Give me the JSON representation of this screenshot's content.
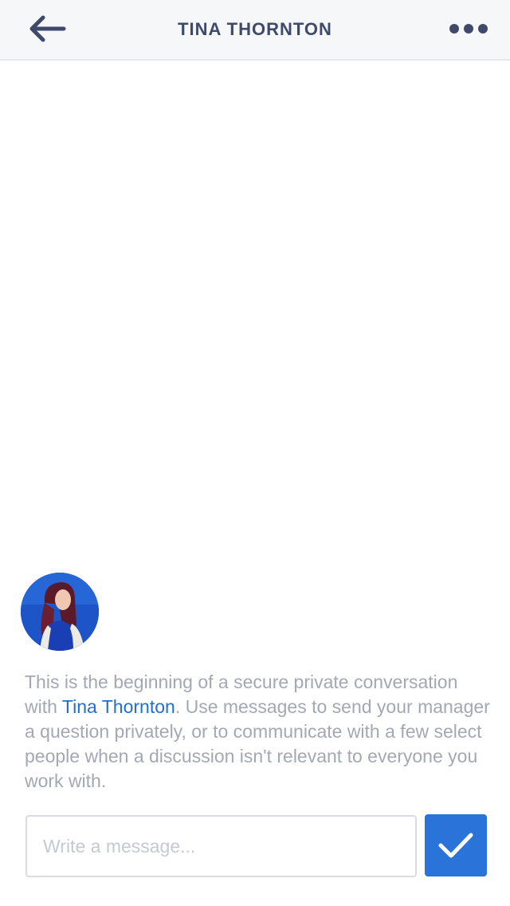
{
  "header": {
    "title": "TINA THORNTON",
    "back_icon": "arrow-left-icon",
    "more_icon": "more-dots-icon"
  },
  "intro": {
    "text_before": "This is the beginning of a secure private conversation with ",
    "contact_name": "Tina Thornton",
    "text_after": ". Use messages to send your manager a question privately, or to communicate with a few select people when a discussion isn't  relevant to everyone you work with."
  },
  "composer": {
    "placeholder": "Write a message...",
    "value": "",
    "send_icon": "checkmark-icon"
  },
  "colors": {
    "header_bg": "#f6f7f9",
    "header_text": "#3f4a6b",
    "link": "#1f6fd6",
    "body_text": "#a3a8b4",
    "send_button": "#2a73d9"
  }
}
